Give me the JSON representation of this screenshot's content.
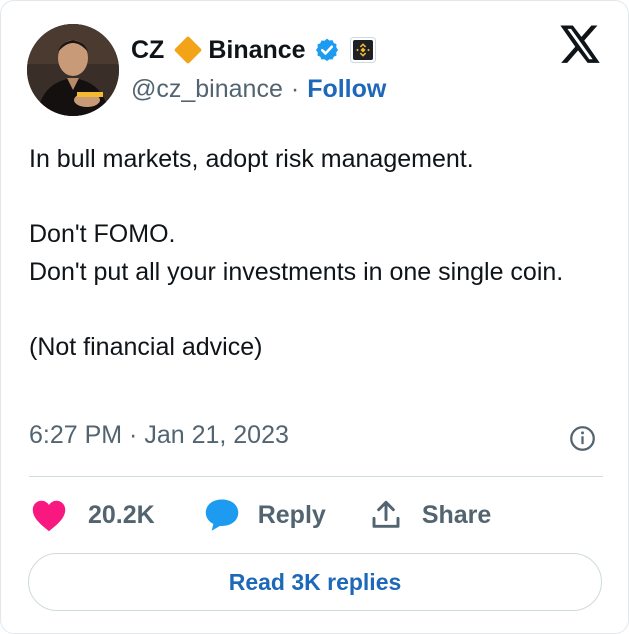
{
  "author": {
    "name": "CZ",
    "affiliation": "Binance",
    "handle": "@cz_binance",
    "separator": "·",
    "follow_label": "Follow"
  },
  "tweet": {
    "paragraphs": [
      "In bull markets, adopt risk management.",
      "Don't FOMO.\nDon't put all your investments in one single coin.",
      "(Not financial advice)"
    ],
    "timestamp": "6:27 PM · Jan 21, 2023"
  },
  "actions": {
    "likes_count": "20.2K",
    "reply_label": "Reply",
    "share_label": "Share"
  },
  "read_replies_label": "Read 3K replies",
  "icons": {
    "logo": "x-logo-icon",
    "verified": "verified-badge-icon",
    "affiliation": "binance-logo-icon",
    "like": "heart-icon",
    "reply": "speech-bubble-icon",
    "share": "share-upload-icon",
    "info": "info-icon"
  },
  "colors": {
    "heart": "#f91880",
    "reply_bubble": "#1d9bf0",
    "link": "#1d68b8",
    "verified": "#1d9bf0",
    "binance": "#f3ba2f",
    "diamond": "#f3a318",
    "text_secondary": "#536471"
  }
}
